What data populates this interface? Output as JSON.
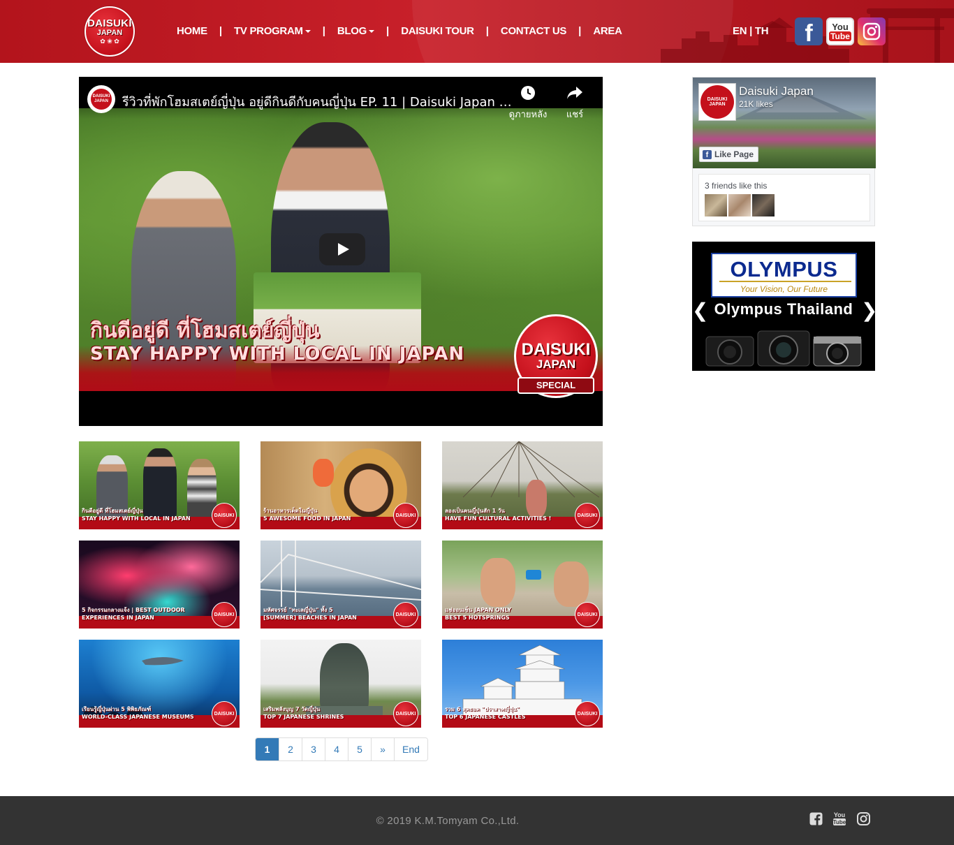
{
  "header": {
    "logo": {
      "line1": "DAISUKI",
      "line2": "JAPAN"
    },
    "nav": {
      "home": "HOME",
      "tv_program": "TV PROGRAM",
      "blog": "BLOG",
      "daisuki_tour": "DAISUKI TOUR",
      "contact_us": "CONTACT US",
      "area": "AREA",
      "separator": "|"
    },
    "lang": {
      "en": "EN",
      "separator": " | ",
      "th": "TH"
    },
    "social": [
      "facebook-icon",
      "youtube-icon",
      "instagram-icon"
    ],
    "youtube_you": "You",
    "youtube_tube": "Tube",
    "facebook_letter": "f",
    "brand_color": "#c8202a"
  },
  "video": {
    "title": "รีวิวที่พักโฮมสเตย์ญี่ปุ่น อยู่ดีกินดีกับคนญี่ปุ่น EP. 11 | Daisuki Japan Sp...",
    "watch_later_label": "ดูภายหลัง",
    "share_label": "แชร์",
    "channel_avatar_text": "DAISUKI JAPAN",
    "caption_th": "กินดีอยู่ดี ที่โฮมสเตย์ญี่ปุ่น",
    "caption_en": "STAY HAPPY WITH LOCAL IN JAPAN",
    "badge_line1": "DAISUKI",
    "badge_line2": "JAPAN",
    "badge_ribbon": "SPECIAL"
  },
  "thumbnails": [
    {
      "caption": "กินดีอยู่ดี ที่โฮมสเตย์ญี่ปุ่น\nSTAY HAPPY WITH LOCAL IN JAPAN",
      "badge": "DAISUKI"
    },
    {
      "caption": "ร้านอาหารเด็ดในญี่ปุ่น\n5 AWESOME FOOD IN JAPAN",
      "badge": "DAISUKI"
    },
    {
      "caption": "ลองเป็นคนญี่ปุ่นสัก 1 วัน\nHAVE FUN CULTURAL ACTIVITIES !",
      "badge": "DAISUKI"
    },
    {
      "caption": "5 กิจกรรมกลางแจ้ง | BEST OUTDOOR\nEXPERIENCES IN JAPAN",
      "badge": "DAISUKI"
    },
    {
      "caption": "มหัศจรรย์ \"ทะเลญี่ปุ่น\" ทั้ง 5\n[SUMMER] BEACHES IN JAPAN",
      "badge": "DAISUKI"
    },
    {
      "caption": "แช่ออนเซ็น JAPAN ONLY\nBEST 5 HOTSPRINGS",
      "badge": "DAISUKI"
    },
    {
      "caption": "เรียนรู้ญี่ปุ่นผ่าน 5 พิพิธภัณฑ์\nWORLD-CLASS JAPANESE MUSEUMS",
      "badge": "DAISUKI"
    },
    {
      "caption": "เสริมพลังบุญ 7 วัดญี่ปุ่น\nTOP 7 JAPANESE SHRINES",
      "badge": "DAISUKI"
    },
    {
      "caption": "รวม 6 สุดยอด \"ปราสาทญี่ปุ่น\"\nTOP 6 JAPANESE CASTLES",
      "badge": "DAISUKI"
    }
  ],
  "pagination": {
    "pages": [
      "1",
      "2",
      "3",
      "4",
      "5"
    ],
    "active": "1",
    "next": "»",
    "end": "End"
  },
  "facebook_widget": {
    "page_name": "Daisuki Japan",
    "likes": "21K likes",
    "like_button": "Like Page",
    "friends_text": "3 friends like this",
    "avatar_text": "DAISUKI JAPAN"
  },
  "ad": {
    "brand": "OLYMPUS",
    "tagline": "Your Vision, Our Future",
    "title": "Olympus Thailand",
    "prev": "❮",
    "next": "❯"
  },
  "footer": {
    "copyright": "© 2019 K.M.Tomyam Co.,Ltd.",
    "icons": [
      "facebook-square-icon",
      "youtube-icon",
      "instagram-icon"
    ],
    "youtube_label": "You\nTube"
  }
}
